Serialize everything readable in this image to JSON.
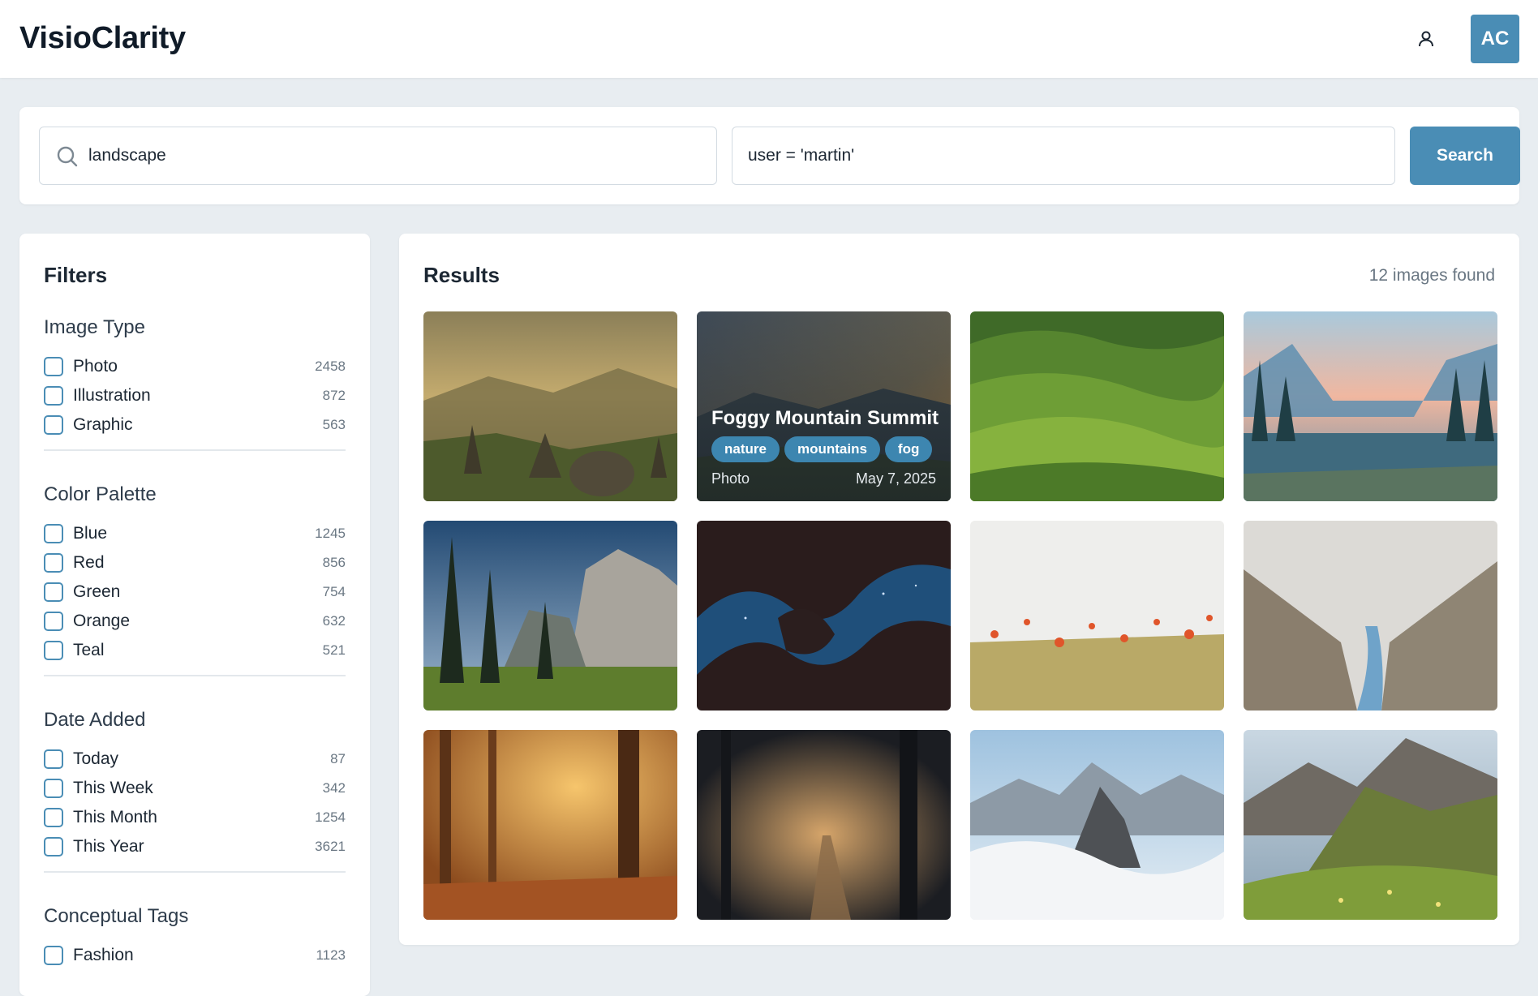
{
  "app": {
    "name": "VisioClarity"
  },
  "header": {
    "avatar_initials": "AC"
  },
  "search": {
    "query": "landscape",
    "filter_expression": "user = 'martin'",
    "button_label": "Search"
  },
  "filters": {
    "title": "Filters",
    "groups": [
      {
        "title": "Image Type",
        "options": [
          {
            "label": "Photo",
            "count": "2458"
          },
          {
            "label": "Illustration",
            "count": "872"
          },
          {
            "label": "Graphic",
            "count": "563"
          }
        ]
      },
      {
        "title": "Color Palette",
        "options": [
          {
            "label": "Blue",
            "count": "1245"
          },
          {
            "label": "Red",
            "count": "856"
          },
          {
            "label": "Green",
            "count": "754"
          },
          {
            "label": "Orange",
            "count": "632"
          },
          {
            "label": "Teal",
            "count": "521"
          }
        ]
      },
      {
        "title": "Date Added",
        "options": [
          {
            "label": "Today",
            "count": "87"
          },
          {
            "label": "This Week",
            "count": "342"
          },
          {
            "label": "This Month",
            "count": "1254"
          },
          {
            "label": "This Year",
            "count": "3621"
          }
        ]
      },
      {
        "title": "Conceptual Tags",
        "options": [
          {
            "label": "Fashion",
            "count": "1123"
          }
        ]
      }
    ]
  },
  "results": {
    "title": "Results",
    "count_text": "12 images found",
    "hovered": {
      "title": "Foggy Mountain Summit",
      "tags": [
        "nature",
        "mountains",
        "fog"
      ],
      "type": "Photo",
      "date": "May 7, 2025"
    }
  },
  "colors": {
    "accent": "#4a8db5",
    "background": "#e8edf1"
  }
}
